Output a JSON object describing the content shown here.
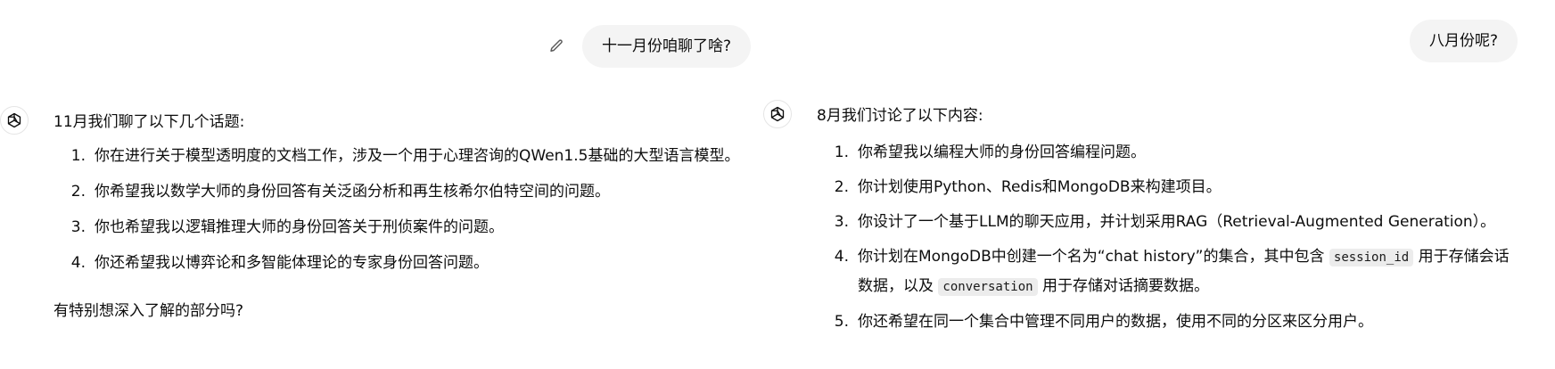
{
  "left": {
    "user_message": "十一月份咱聊了啥?",
    "assistant": {
      "intro": "11月我们聊了以下几个话题:",
      "items": [
        {
          "num": "1.",
          "text": "你在进行关于模型透明度的文档工作，涉及一个用于心理咨询的QWen1.5基础的大型语言模型。"
        },
        {
          "num": "2.",
          "text": "你希望我以数学大师的身份回答有关泛函分析和再生核希尔伯特空间的问题。"
        },
        {
          "num": "3.",
          "text": "你也希望我以逻辑推理大师的身份回答关于刑侦案件的问题。"
        },
        {
          "num": "4.",
          "text": "你还希望我以博弈论和多智能体理论的专家身份回答问题。"
        }
      ],
      "outro": "有特别想深入了解的部分吗?"
    }
  },
  "right": {
    "user_message": "八月份呢?",
    "assistant": {
      "intro": "8月我们讨论了以下内容:",
      "items": [
        {
          "num": "1.",
          "text": "你希望我以编程大师的身份回答编程问题。"
        },
        {
          "num": "2.",
          "text": "你计划使用Python、Redis和MongoDB来构建项目。"
        },
        {
          "num": "3.",
          "text": "你设计了一个基于LLM的聊天应用，并计划采用RAG（Retrieval-Augmented Generation）。"
        },
        {
          "num": "4.",
          "text_a": "你计划在MongoDB中创建一个名为“chat history”的集合，其中包含",
          "code_a": "session_id",
          "text_b": "用于存储会话",
          "text_c": "数据，以及",
          "code_b": "conversation",
          "text_d": "用于存储对话摘要数据。"
        },
        {
          "num": "5.",
          "text": "你还希望在同一个集合中管理不同用户的数据，使用不同的分区来区分用户。"
        }
      ]
    }
  },
  "icons": {
    "edit": "pencil-icon",
    "assistant_avatar": "openai-logo-icon"
  }
}
